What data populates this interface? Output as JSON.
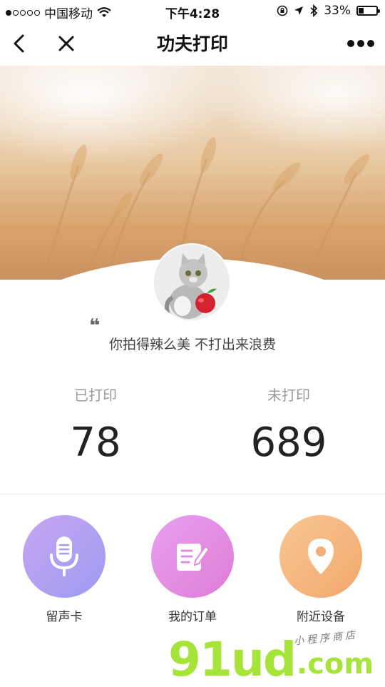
{
  "status_bar": {
    "carrier": "中国移动",
    "time": "下午4:28",
    "battery_percent": "33%",
    "battery_level": 0.33
  },
  "nav": {
    "title": "功夫打印"
  },
  "profile": {
    "quote_mark": "❝",
    "motto": "你拍得辣么美  不打出来浪费"
  },
  "stats": {
    "printed_label": "已打印",
    "printed_value": "78",
    "unprinted_label": "未打印",
    "unprinted_value": "689"
  },
  "actions": [
    {
      "label": "留声卡",
      "icon": "microphone-icon"
    },
    {
      "label": "我的订单",
      "icon": "edit-document-icon"
    },
    {
      "label": "附近设备",
      "icon": "location-pin-icon"
    }
  ],
  "watermark": {
    "brand": "91ud",
    "domain": ".com",
    "tagline": "小程序商店"
  }
}
